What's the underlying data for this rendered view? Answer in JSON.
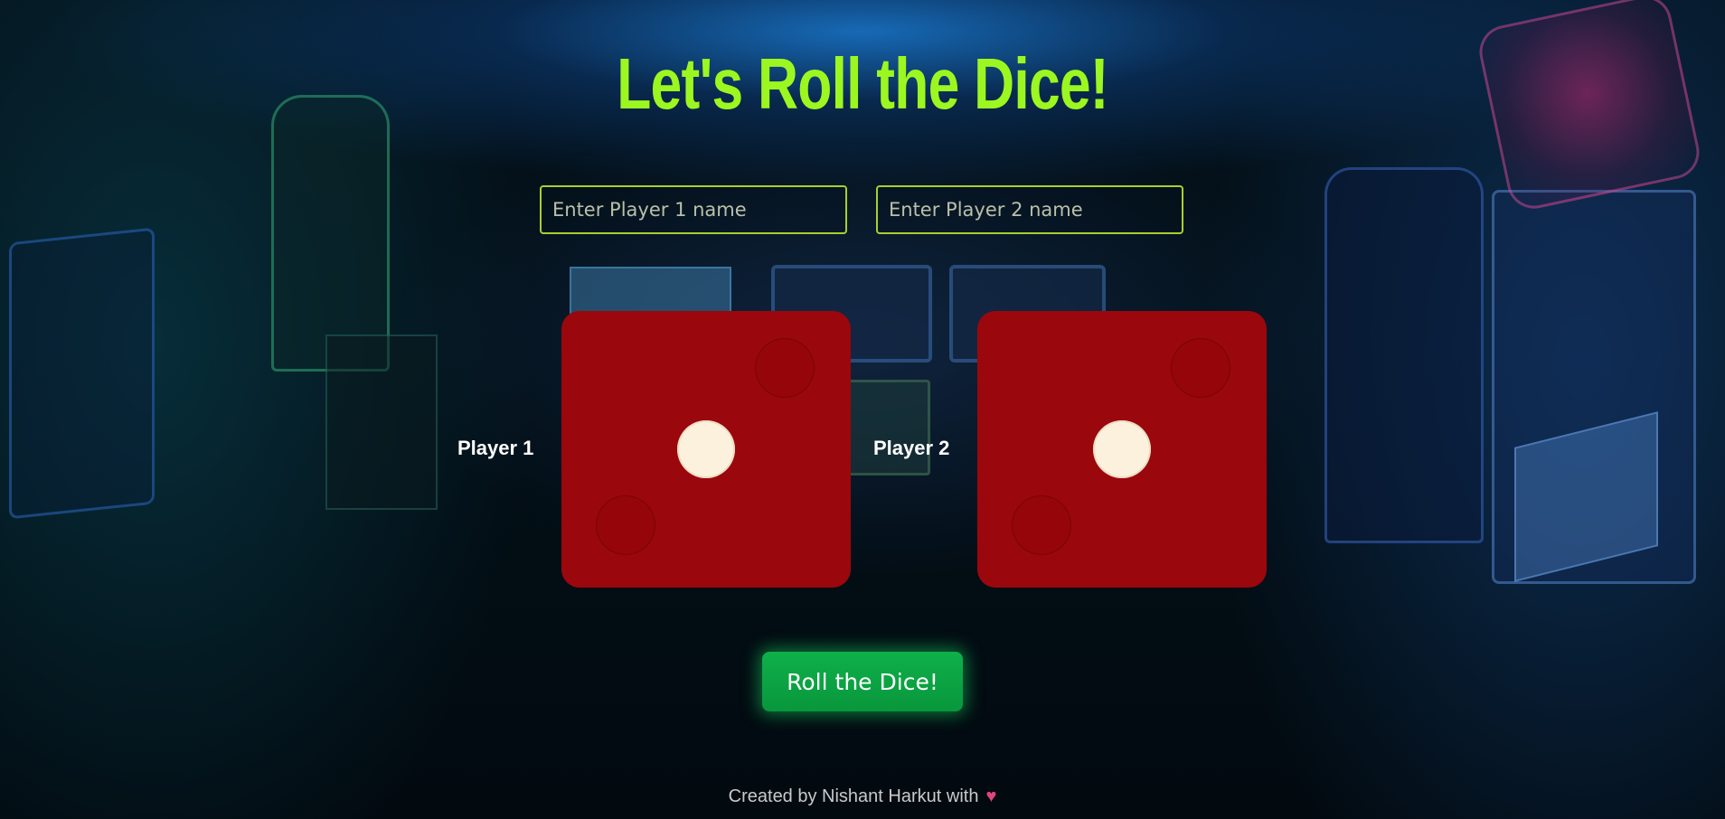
{
  "title": "Let's Roll the Dice!",
  "inputs": {
    "player1_placeholder": "Enter Player 1 name",
    "player2_placeholder": "Enter Player 2 name",
    "player1_value": "",
    "player2_value": ""
  },
  "players": [
    {
      "label": "Player 1",
      "die_value": 1
    },
    {
      "label": "Player 2",
      "die_value": 1
    }
  ],
  "roll_button_label": "Roll the Dice!",
  "footer": {
    "text": "Created by Nishant Harkut with",
    "icon": "heart-icon"
  },
  "colors": {
    "title": "#9cf720",
    "die": "#9a070c",
    "pip": "#fbf1dc",
    "input_border": "#a8d02c",
    "button": "#0fb04a",
    "heart": "#e0457a"
  }
}
